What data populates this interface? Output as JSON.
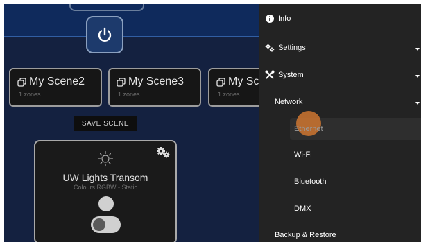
{
  "scenes": [
    {
      "name": "My Scene2",
      "zones": "1 zones"
    },
    {
      "name": "My Scene3",
      "zones": "1 zones"
    },
    {
      "name": "My Sc",
      "zones": "1 zones"
    }
  ],
  "save_scene_label": "SAVE SCENE",
  "light": {
    "name": "UW Lights Transom",
    "mode": "Colours RGBW - Static"
  },
  "menu": {
    "info": "Info",
    "settings": "Settings",
    "system": "System",
    "network": "Network",
    "ethernet": "Ethernet",
    "wifi": "Wi-Fi",
    "bluetooth": "Bluetooth",
    "dmx": "DMX",
    "backup": "Backup & Restore"
  },
  "colors": {
    "ripple": "#ce7630",
    "menu_bg": "#232323",
    "top_bar": "#0f2a5c"
  },
  "icons": [
    "power-icon",
    "scene-icon",
    "sun-icon",
    "gear-icon",
    "info-icon",
    "settings-icon",
    "tools-icon"
  ]
}
